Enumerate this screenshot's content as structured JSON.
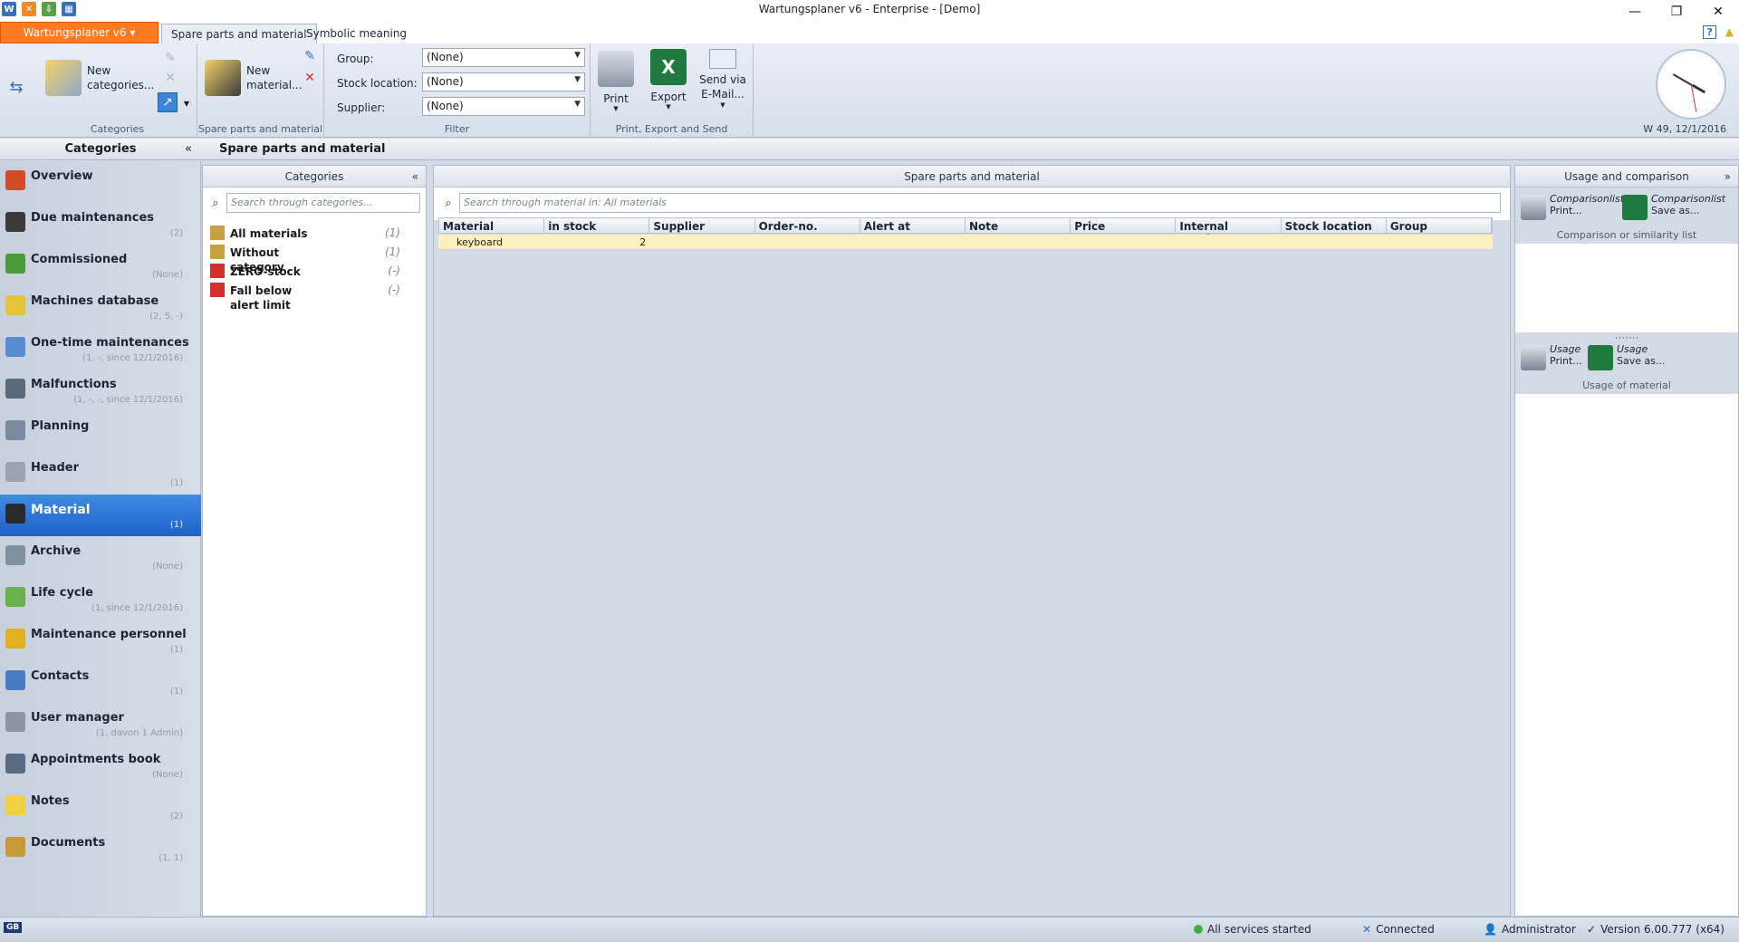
{
  "window": {
    "title": "Wartungsplaner v6 - Enterprise - [Demo]",
    "minimize": "—",
    "restore": "❐",
    "close": "✕"
  },
  "tabs": {
    "app_tab": "Wartungsplaner v6 ▾",
    "items": [
      "Spare parts and material",
      "Symbolic meaning"
    ]
  },
  "ribbon": {
    "new_categories": "New categories...",
    "categories_group": "Categories",
    "new_material": "New material...",
    "spare_group": "Spare parts and material",
    "filter_group": "Filter",
    "filters": [
      {
        "label": "Group:",
        "value": "(None)"
      },
      {
        "label": "Stock location:",
        "value": "(None)"
      },
      {
        "label": "Supplier:",
        "value": "(None)"
      }
    ],
    "print": "Print",
    "export": "Export",
    "send": "Send via E-Mail...",
    "print_group": "Print, Export and Send",
    "clock_date": "W 49, 12/1/2016"
  },
  "headers": {
    "categories": "Categories",
    "spare": "Spare parts and material"
  },
  "nav": [
    {
      "label": "Overview",
      "count": "",
      "color": "#d14a2a"
    },
    {
      "label": "Due maintenances",
      "count": "(2)",
      "color": "#3a3a3a"
    },
    {
      "label": "Commissioned",
      "count": "(None)",
      "color": "#4a9a3a"
    },
    {
      "label": "Machines database",
      "count": "(2, 5, -)",
      "color": "#e4c33a"
    },
    {
      "label": "One-time maintenances",
      "count": "(1, -, since 12/1/2016)",
      "color": "#5a8acf"
    },
    {
      "label": "Malfunctions",
      "count": "(1, -, -, since 12/1/2016)",
      "color": "#5a6a7a"
    },
    {
      "label": "Planning",
      "count": "",
      "color": "#7a8aa0"
    },
    {
      "label": "Header",
      "count": "(1)",
      "color": "#9aa5b3"
    },
    {
      "label": "Material",
      "count": "(1)",
      "color": "#2a2a2a"
    },
    {
      "label": "Archive",
      "count": "(None)",
      "color": "#8090a0"
    },
    {
      "label": "Life cycle",
      "count": "(1, since 12/1/2016)",
      "color": "#6ab04c"
    },
    {
      "label": "Maintenance personnel",
      "count": "(1)",
      "color": "#e0b020"
    },
    {
      "label": "Contacts",
      "count": "(1)",
      "color": "#4a7ac0"
    },
    {
      "label": "User manager",
      "count": "(1, davon 1 Admin)",
      "color": "#8a96a6"
    },
    {
      "label": "Appointments book",
      "count": "(None)",
      "color": "#5a6a80"
    },
    {
      "label": "Notes",
      "count": "(2)",
      "color": "#f0d040"
    },
    {
      "label": "Documents",
      "count": "(1, 1)",
      "color": "#c89a3a"
    }
  ],
  "cat_panel": {
    "title": "Categories",
    "search_placeholder": "Search through categories...",
    "rows": [
      {
        "label": "All materials",
        "count": "(1)",
        "color": "#c8a040"
      },
      {
        "label": "Without category",
        "count": "(1)",
        "color": "#c8a040"
      },
      {
        "label": "ZERO-stock",
        "count": "(-)",
        "color": "#d32f2f"
      },
      {
        "label": "Fall below alert limit",
        "count": "(-)",
        "color": "#d32f2f"
      }
    ]
  },
  "spare_panel": {
    "title": "Spare parts and material",
    "search_placeholder": "Search through material in: All materials",
    "columns": [
      "Material",
      "in stock",
      "Supplier",
      "Order-no.",
      "Alert at",
      "Note",
      "Price",
      "Internal number",
      "Stock location",
      "Group"
    ],
    "rows": [
      [
        "keyboard",
        "2",
        "",
        "",
        "",
        "",
        "",
        "",
        "",
        ""
      ]
    ]
  },
  "usage_panel": {
    "title": "Usage and comparison",
    "comp_print_t1": "Comparisonlist",
    "comp_print_t2": "Print...",
    "comp_save_t1": "Comparisonlist",
    "comp_save_t2": "Save as...",
    "comp_label": "Comparison or similarity list",
    "usage_print_t1": "Usage",
    "usage_print_t2": "Print...",
    "usage_save_t1": "Usage",
    "usage_save_t2": "Save as...",
    "usage_label": "Usage of material"
  },
  "status": {
    "services": "All services started",
    "connected": "Connected",
    "user": "Administrator",
    "version": "Version 6.00.777 (x64)"
  }
}
